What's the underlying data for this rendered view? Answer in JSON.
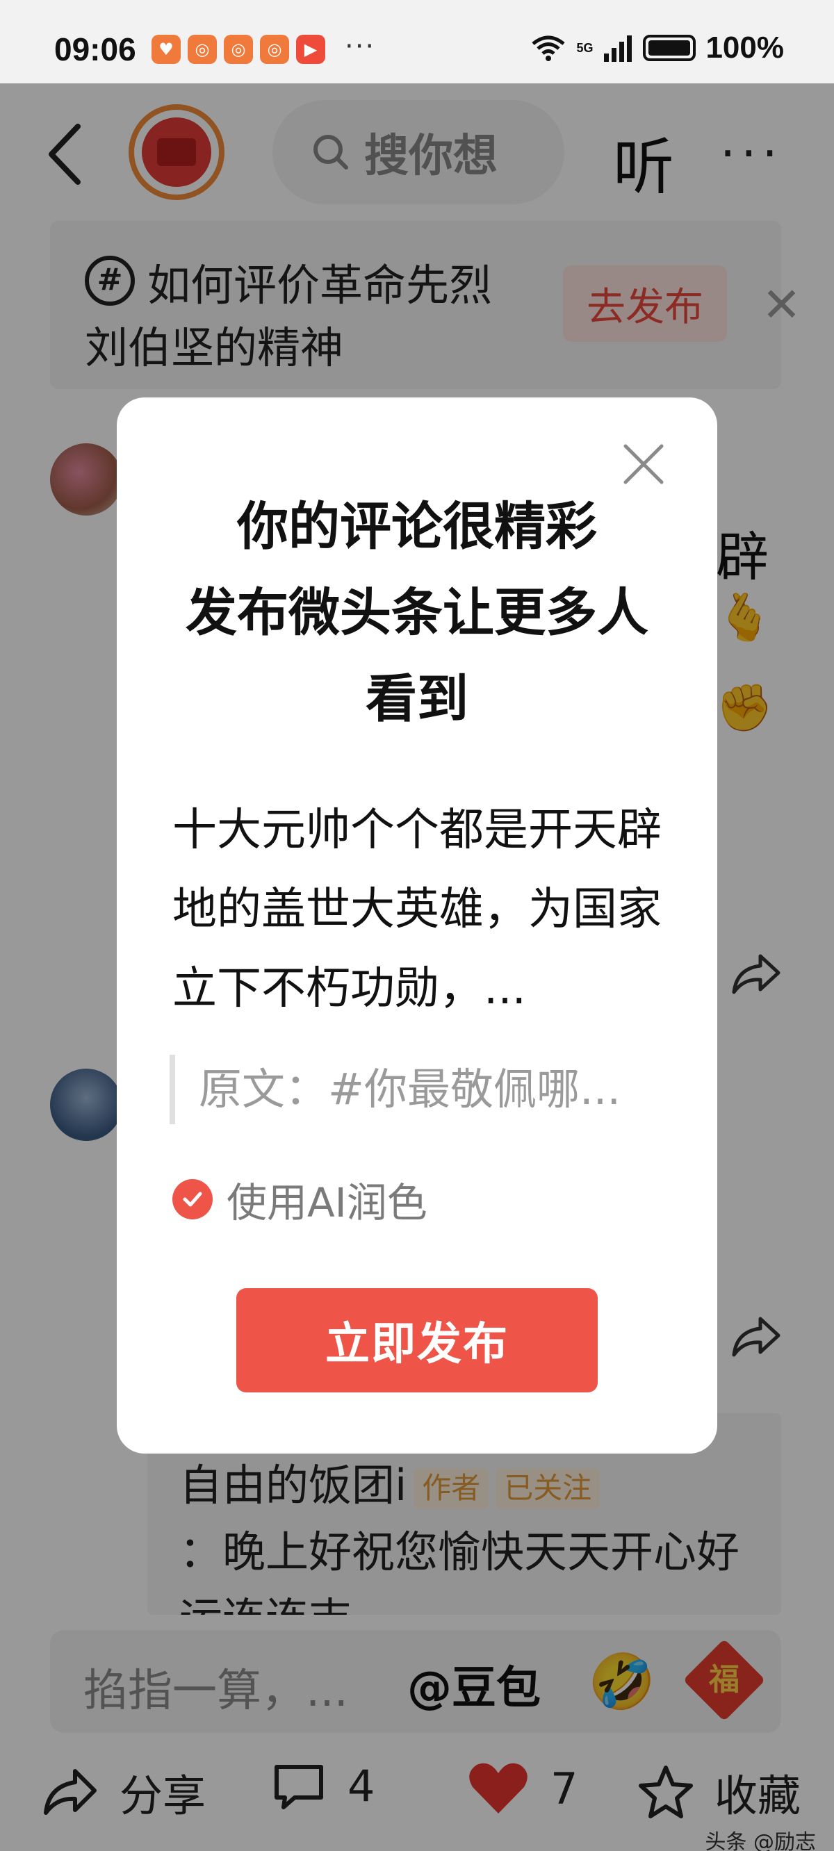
{
  "status_bar": {
    "time": "09:06",
    "network": "5G",
    "battery": "100%"
  },
  "header": {
    "search_placeholder": "搜你想",
    "listen_label": "听"
  },
  "topic_banner": {
    "text": "如何评价革命先烈刘伯坚的精神",
    "button": "去发布"
  },
  "comments": {
    "visible_fragment": "辟",
    "reply": {
      "author": "自由的饭团i",
      "author_tag": "作者",
      "follow_tag": "已关注",
      "text": "：晚上好祝您愉快天天开心好运连连吉..."
    }
  },
  "input_bar": {
    "placeholder": "掐指一算，...",
    "mention": "@豆包",
    "fu_sticker": "福"
  },
  "action_bar": {
    "share_label": "分享",
    "comment_count": "4",
    "like_count": "7",
    "collect_label": "收藏"
  },
  "watermark": "头条 @励志",
  "dialog": {
    "title_line1": "你的评论很精彩",
    "title_line2": "发布微头条让更多人",
    "title_line3": "看到",
    "body": "十大元帅个个都是开天辟地的盖世大英雄，为国家立下不朽功勋，...",
    "source": "原文：#你最敬佩哪...",
    "ai_option_label": "使用AI润色",
    "ai_option_checked": true,
    "publish_button": "立即发布"
  },
  "colors": {
    "accent_red": "#ee5548",
    "overlay": "rgba(0,0,0,0.40)"
  }
}
